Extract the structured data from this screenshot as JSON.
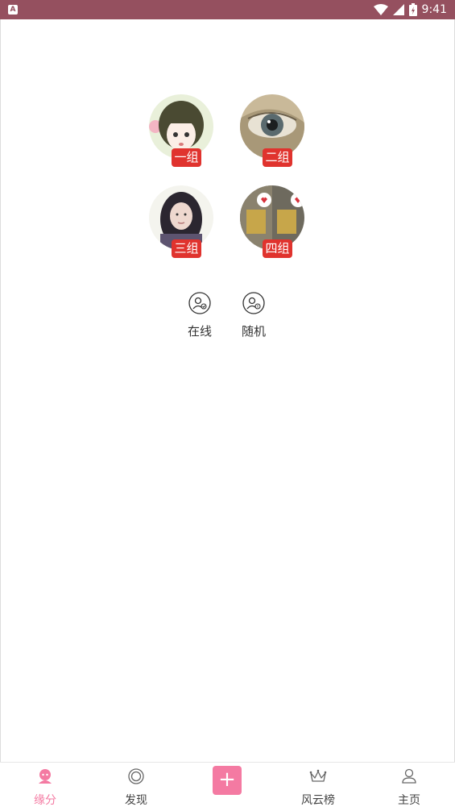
{
  "status_bar": {
    "time": "9:41",
    "app_badge": "A",
    "background": "#95505f"
  },
  "groups": [
    {
      "badge": "一组",
      "avatar": "anime-girl-avatar"
    },
    {
      "badge": "二组",
      "avatar": "eye-avatar"
    },
    {
      "badge": "三组",
      "avatar": "girl-photo-avatar"
    },
    {
      "badge": "四组",
      "avatar": "hearts-photo-avatar"
    }
  ],
  "modes": [
    {
      "label": "在线",
      "icon": "user-online-icon"
    },
    {
      "label": "随机",
      "icon": "user-random-icon"
    }
  ],
  "tab_bar": {
    "tabs": [
      {
        "label": "缘分",
        "icon": "match-icon",
        "active": true
      },
      {
        "label": "发现",
        "icon": "discover-icon",
        "active": false
      },
      {
        "label": "风云榜",
        "icon": "crown-icon",
        "active": false
      },
      {
        "label": "主页",
        "icon": "profile-icon",
        "active": false
      }
    ],
    "plus_label": "+"
  },
  "colors": {
    "accent": "#f47aa2",
    "badge": "#e0332e"
  }
}
